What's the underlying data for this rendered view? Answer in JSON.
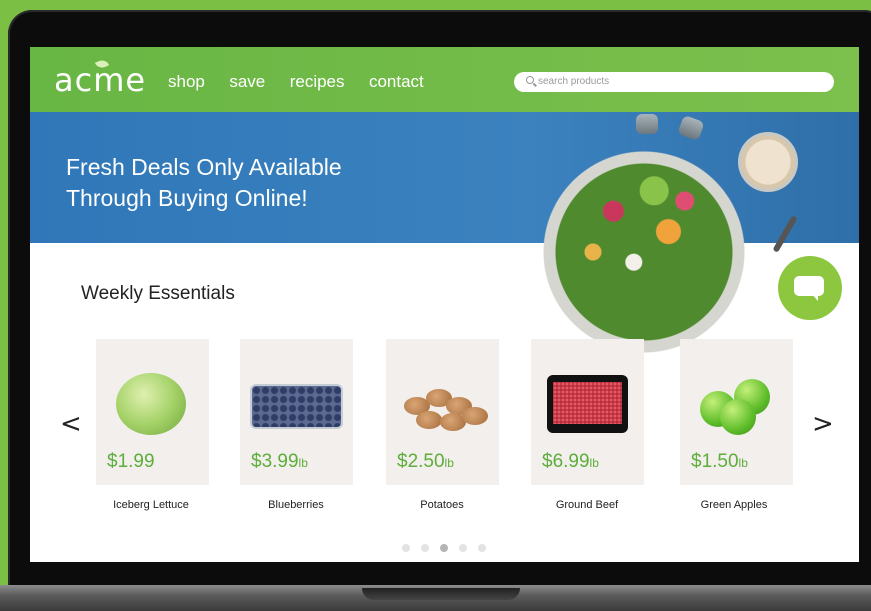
{
  "nav": {
    "logo": "acme",
    "links": [
      "shop",
      "save",
      "recipes",
      "contact"
    ],
    "search_placeholder": "search products"
  },
  "hero": {
    "line1": "Fresh Deals Only Available",
    "line2": "Through Buying Online!"
  },
  "section": {
    "title": "Weekly Essentials",
    "prev_arrow": "<",
    "next_arrow": ">"
  },
  "products": [
    {
      "name": "Iceberg Lettuce",
      "price": "$1.99",
      "unit": ""
    },
    {
      "name": "Blueberries",
      "price": "$3.99",
      "unit": "lb"
    },
    {
      "name": "Potatoes",
      "price": "$2.50",
      "unit": "lb"
    },
    {
      "name": "Ground Beef",
      "price": "$6.99",
      "unit": "lb"
    },
    {
      "name": "Green Apples",
      "price": "$1.50",
      "unit": "lb"
    }
  ],
  "carousel": {
    "pages": 5,
    "active_page": 3
  },
  "colors": {
    "brand_green": "#6bb745",
    "hero_blue": "#3480bd",
    "price_green": "#5eae3b"
  }
}
